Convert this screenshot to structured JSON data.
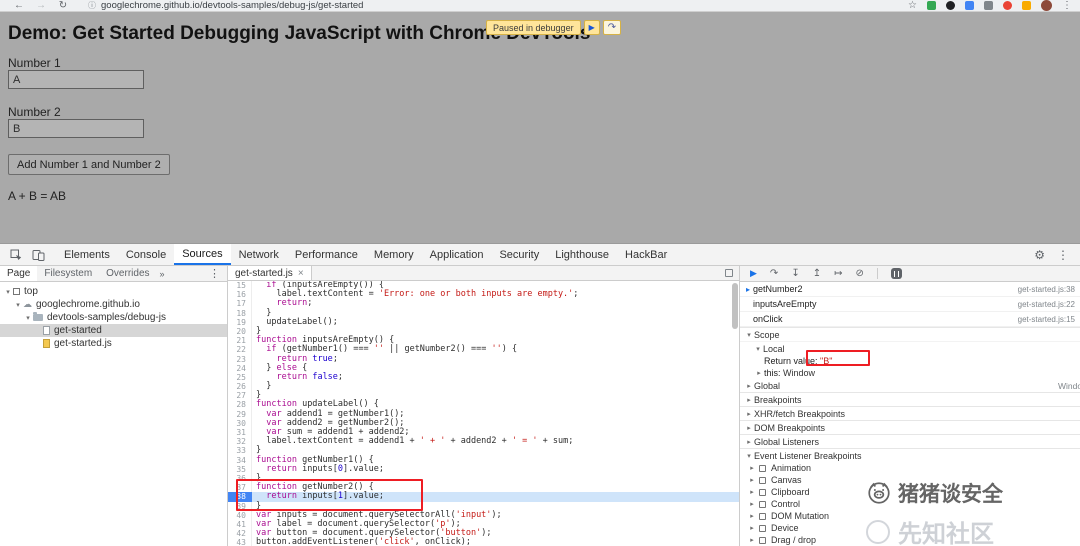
{
  "browser": {
    "url": "googlechrome.github.io/devtools-samples/debug-js/get-started",
    "icons": {
      "back": "←",
      "forward": "→",
      "refresh": "↻",
      "info": "ⓘ",
      "star": "☆",
      "menu": "⋮"
    }
  },
  "paused_banner": {
    "label": "Paused in debugger",
    "resume_icon": "▶",
    "step_over_icon": "↷"
  },
  "demo_page": {
    "title": "Demo: Get Started Debugging JavaScript with Chrome DevTools",
    "number1_label": "Number 1",
    "number1_value": "A",
    "number2_label": "Number 2",
    "number2_value": "B",
    "add_button_label": "Add Number 1 and Number 2",
    "result_text": "A + B = AB"
  },
  "devtools": {
    "tabs": [
      "Elements",
      "Console",
      "Sources",
      "Network",
      "Performance",
      "Memory",
      "Application",
      "Security",
      "Lighthouse",
      "HackBar"
    ],
    "selected_tab": "Sources",
    "tabbar_icons": {
      "gear": "⚙",
      "menu": "⋮"
    },
    "sidebar": {
      "tabs": [
        "Page",
        "Filesystem",
        "Overrides"
      ],
      "selected_tab": "Page",
      "more_chevron": "»",
      "menu_icon": "⋮",
      "caret_down": "▾",
      "tree": [
        {
          "label": "top",
          "depth": 0,
          "icon": "frame-icon",
          "expanded": true
        },
        {
          "label": "googlechrome.github.io",
          "depth": 1,
          "icon": "cloud-icon",
          "expanded": true
        },
        {
          "label": "devtools-samples/debug-js",
          "depth": 2,
          "icon": "folder-icon",
          "expanded": true
        },
        {
          "label": "get-started",
          "depth": 3,
          "icon": "file-icon",
          "selected": true
        },
        {
          "label": "get-started.js",
          "depth": 3,
          "icon": "js-file-icon"
        }
      ]
    },
    "editor": {
      "tab_label": "get-started.js",
      "close_icon": "×",
      "current_line": 38,
      "lines": [
        {
          "n": 15,
          "s": [
            [
              "p",
              "  "
            ],
            [
              "k",
              "if"
            ],
            [
              "p",
              " (inputsAreEmpty()) {"
            ]
          ]
        },
        {
          "n": 16,
          "s": [
            [
              "p",
              "    label.textContent = "
            ],
            [
              "s",
              "'Error: one or both inputs are empty.'"
            ],
            [
              "p",
              ";"
            ]
          ]
        },
        {
          "n": 17,
          "s": [
            [
              "p",
              "    "
            ],
            [
              "k",
              "return"
            ],
            [
              "p",
              ";"
            ]
          ]
        },
        {
          "n": 18,
          "s": [
            [
              "p",
              "  }"
            ]
          ]
        },
        {
          "n": 19,
          "s": [
            [
              "p",
              "  updateLabel();"
            ]
          ]
        },
        {
          "n": 20,
          "s": [
            [
              "p",
              "}"
            ]
          ]
        },
        {
          "n": 21,
          "s": [
            [
              "k",
              "function"
            ],
            [
              "p",
              " inputsAreEmpty() {"
            ]
          ]
        },
        {
          "n": 22,
          "s": [
            [
              "p",
              "  "
            ],
            [
              "k",
              "if"
            ],
            [
              "p",
              " (getNumber1() === "
            ],
            [
              "s",
              "''"
            ],
            [
              "p",
              " || getNumber2() === "
            ],
            [
              "s",
              "''"
            ],
            [
              "p",
              ") {"
            ]
          ]
        },
        {
          "n": 23,
          "s": [
            [
              "p",
              "    "
            ],
            [
              "k",
              "return"
            ],
            [
              "p",
              " "
            ],
            [
              "n",
              "true"
            ],
            [
              "p",
              ";"
            ]
          ]
        },
        {
          "n": 24,
          "s": [
            [
              "p",
              "  } "
            ],
            [
              "k",
              "else"
            ],
            [
              "p",
              " {"
            ]
          ]
        },
        {
          "n": 25,
          "s": [
            [
              "p",
              "    "
            ],
            [
              "k",
              "return"
            ],
            [
              "p",
              " "
            ],
            [
              "n",
              "false"
            ],
            [
              "p",
              ";"
            ]
          ]
        },
        {
          "n": 26,
          "s": [
            [
              "p",
              "  }"
            ]
          ]
        },
        {
          "n": 27,
          "s": [
            [
              "p",
              "}"
            ]
          ]
        },
        {
          "n": 28,
          "s": [
            [
              "k",
              "function"
            ],
            [
              "p",
              " updateLabel() {"
            ]
          ]
        },
        {
          "n": 29,
          "s": [
            [
              "p",
              "  "
            ],
            [
              "k",
              "var"
            ],
            [
              "p",
              " addend1 = getNumber1();"
            ]
          ]
        },
        {
          "n": 30,
          "s": [
            [
              "p",
              "  "
            ],
            [
              "k",
              "var"
            ],
            [
              "p",
              " addend2 = getNumber2();"
            ]
          ]
        },
        {
          "n": 31,
          "s": [
            [
              "p",
              "  "
            ],
            [
              "k",
              "var"
            ],
            [
              "p",
              " sum = addend1 + addend2;"
            ]
          ]
        },
        {
          "n": 32,
          "s": [
            [
              "p",
              "  label.textContent = addend1 + "
            ],
            [
              "s",
              "' + '"
            ],
            [
              "p",
              " + addend2 + "
            ],
            [
              "s",
              "' = '"
            ],
            [
              "p",
              " + sum;"
            ]
          ]
        },
        {
          "n": 33,
          "s": [
            [
              "p",
              "}"
            ]
          ]
        },
        {
          "n": 34,
          "s": [
            [
              "k",
              "function"
            ],
            [
              "p",
              " getNumber1() {"
            ]
          ]
        },
        {
          "n": 35,
          "s": [
            [
              "p",
              "  "
            ],
            [
              "k",
              "return"
            ],
            [
              "p",
              " inputs["
            ],
            [
              "n",
              "0"
            ],
            [
              "p",
              "].value;"
            ]
          ]
        },
        {
          "n": 36,
          "s": [
            [
              "p",
              "}"
            ]
          ]
        },
        {
          "n": 37,
          "s": [
            [
              "k",
              "function"
            ],
            [
              "p",
              " getNumber2() {"
            ]
          ]
        },
        {
          "n": 38,
          "s": [
            [
              "p",
              "  "
            ],
            [
              "k",
              "return"
            ],
            [
              "p",
              " inputs["
            ],
            [
              "n",
              "1"
            ],
            [
              "p",
              "].value;"
            ]
          ]
        },
        {
          "n": 39,
          "s": [
            [
              "p",
              "}"
            ]
          ]
        },
        {
          "n": 40,
          "s": [
            [
              "k",
              "var"
            ],
            [
              "p",
              " inputs = document.querySelectorAll("
            ],
            [
              "s",
              "'input'"
            ],
            [
              "p",
              ");"
            ]
          ]
        },
        {
          "n": 41,
          "s": [
            [
              "k",
              "var"
            ],
            [
              "p",
              " label = document.querySelector("
            ],
            [
              "s",
              "'p'"
            ],
            [
              "p",
              ");"
            ]
          ]
        },
        {
          "n": 42,
          "s": [
            [
              "k",
              "var"
            ],
            [
              "p",
              " button = document.querySelector("
            ],
            [
              "s",
              "'button'"
            ],
            [
              "p",
              ");"
            ]
          ]
        },
        {
          "n": 43,
          "s": [
            [
              "p",
              "button.addEventListener("
            ],
            [
              "s",
              "'click'"
            ],
            [
              "p",
              ", onClick);"
            ]
          ]
        }
      ]
    },
    "debugger": {
      "icons": {
        "expanded": "▾",
        "collapsed": "▸",
        "current_marker": "▸"
      },
      "control_icons": {
        "resume": "▶",
        "step_over": "↷",
        "step_into": "↧",
        "step_out": "↥",
        "step": "↦",
        "deactivate": "⊘"
      },
      "call_stack": [
        {
          "name": "getNumber2",
          "location": "get-started.js:38",
          "current": true
        },
        {
          "name": "inputsAreEmpty",
          "location": "get-started.js:22",
          "current": false
        },
        {
          "name": "onClick",
          "location": "get-started.js:15",
          "current": false
        }
      ],
      "scope": {
        "header": "Scope",
        "local_label": "Local",
        "return_name": "Return value:",
        "return_value": "\"B\"",
        "this_name": "this:",
        "this_value": "Window",
        "global_label": "Global",
        "global_value": "Window"
      },
      "collapsed_sections": [
        "Breakpoints",
        "XHR/fetch Breakpoints",
        "DOM Breakpoints",
        "Global Listeners"
      ],
      "event_listener_section": "Event Listener Breakpoints",
      "event_listener_items": [
        "Animation",
        "Canvas",
        "Clipboard",
        "Control",
        "DOM Mutation",
        "Device",
        "Drag / drop"
      ]
    }
  },
  "watermarks": {
    "primary": "猪猪谈安全",
    "secondary": "先知社区"
  }
}
